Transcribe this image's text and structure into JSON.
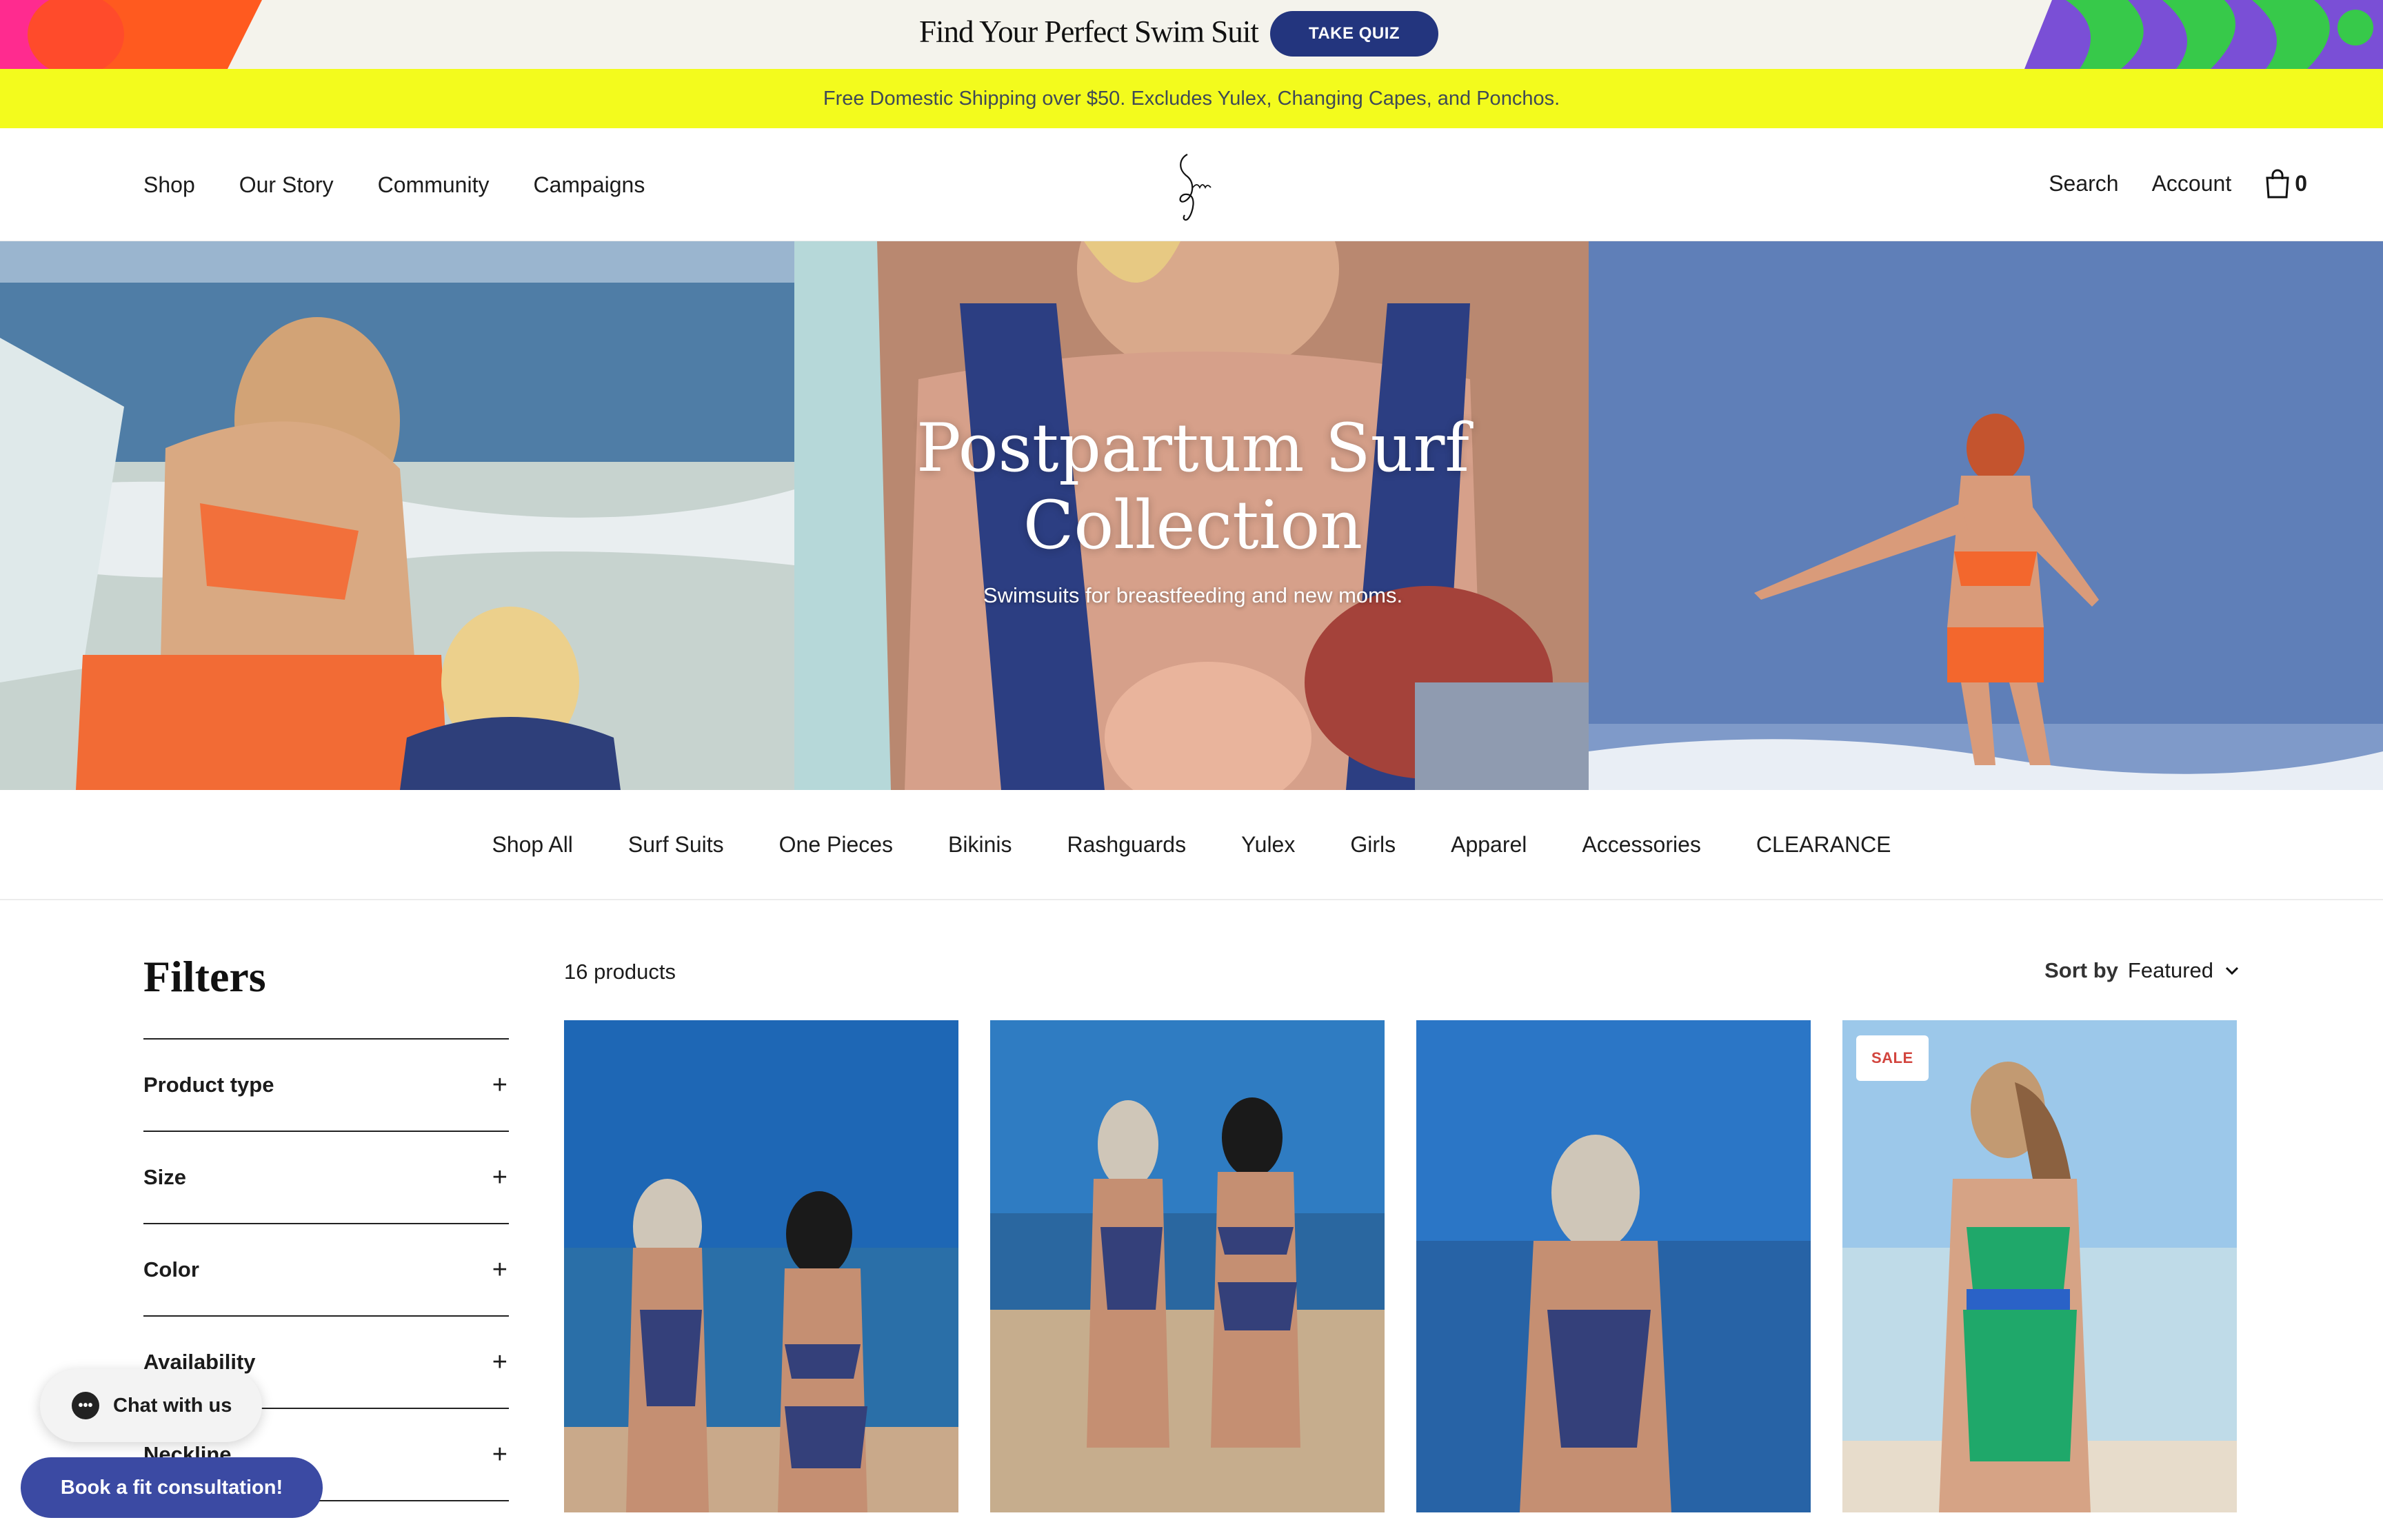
{
  "promo": {
    "title": "Find Your Perfect Swim Suit",
    "button": "TAKE QUIZ"
  },
  "shipping": {
    "text": "Free Domestic Shipping over $50. Excludes Yulex, Changing Capes, and Ponchos."
  },
  "header": {
    "nav": [
      "Shop",
      "Our Story",
      "Community",
      "Campaigns"
    ],
    "logo_text": "Seea",
    "search": "Search",
    "account": "Account",
    "cart_count": "0"
  },
  "hero": {
    "title": "Postpartum Surf Collection",
    "subtitle": "Swimsuits for breastfeeding and new moms."
  },
  "categories": [
    "Shop All",
    "Surf Suits",
    "One Pieces",
    "Bikinis",
    "Rashguards",
    "Yulex",
    "Girls",
    "Apparel",
    "Accessories",
    "CLEARANCE"
  ],
  "filters": {
    "title": "Filters",
    "items": [
      "Product type",
      "Size",
      "Color",
      "Availability",
      "Neckline"
    ]
  },
  "products": {
    "count": "16 products",
    "sort_label": "Sort by",
    "sort_value": "Featured",
    "sale_badge": "SALE"
  },
  "chat": {
    "label": "Chat with us"
  },
  "consult": {
    "label": "Book a fit consultation!"
  },
  "colors": {
    "navy": "#23357e",
    "yellow": "#f3fb1d",
    "consult": "#3b4aa3",
    "sale": "#d2453e"
  }
}
